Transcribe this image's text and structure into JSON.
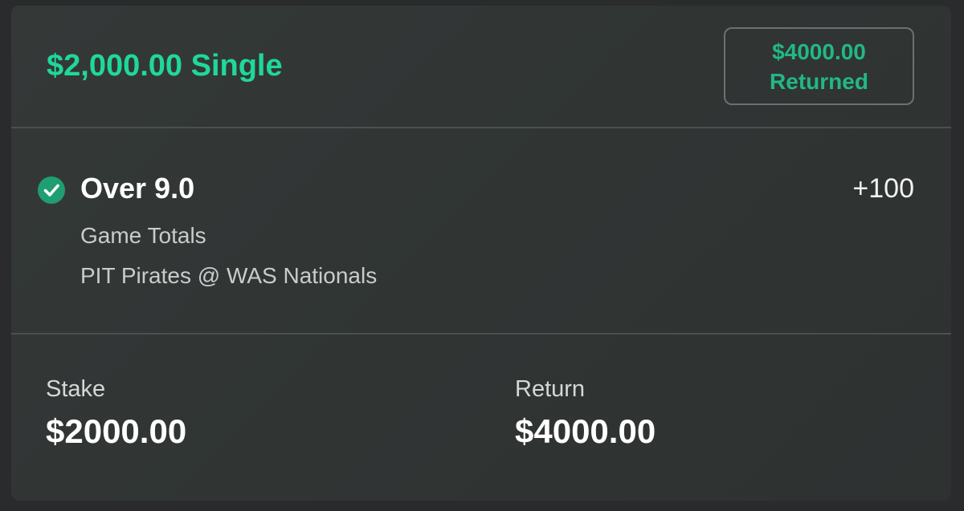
{
  "header": {
    "title": "$2,000.00 Single",
    "badge": {
      "amount": "$4000.00",
      "status": "Returned"
    }
  },
  "selection": {
    "icon": "check-circle-icon",
    "name": "Over 9.0",
    "odds": "+100",
    "market": "Game Totals",
    "event": "PIT Pirates @ WAS Nationals"
  },
  "summary": {
    "stake_label": "Stake",
    "stake_value": "$2000.00",
    "return_label": "Return",
    "return_value": "$4000.00"
  },
  "colors": {
    "accent": "#1fd89a",
    "badge_text": "#22b884",
    "check": "#1f9e72"
  }
}
